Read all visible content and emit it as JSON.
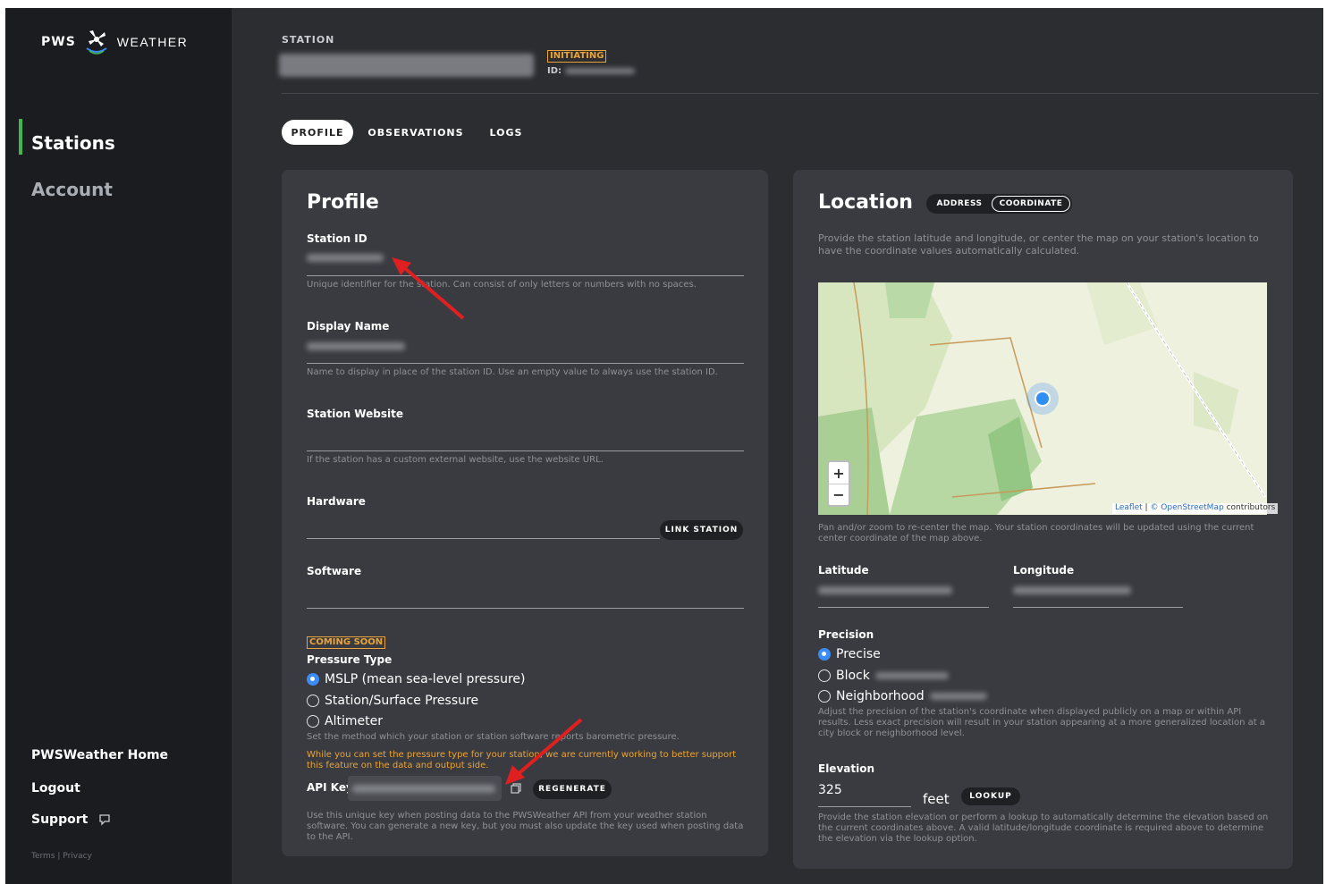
{
  "brand": {
    "pws": "PWS",
    "weather": "WEATHER"
  },
  "nav": {
    "items": [
      {
        "label": "Stations",
        "active": true
      },
      {
        "label": "Account",
        "active": false
      }
    ]
  },
  "footer_links": {
    "home": "PWSWeather Home",
    "logout": "Logout",
    "support": "Support",
    "terms": "Terms",
    "privacy": "Privacy"
  },
  "header": {
    "station_label": "STATION",
    "status": "INITIATING",
    "id_label": "ID:"
  },
  "tabs": [
    "PROFILE",
    "OBSERVATIONS",
    "LOGS"
  ],
  "profile": {
    "title": "Profile",
    "station_id": {
      "label": "Station ID",
      "help": "Unique identifier for the station. Can consist of only letters or numbers with no spaces."
    },
    "display_name": {
      "label": "Display Name",
      "help": "Name to display in place of the station ID. Use an empty value to always use the station ID."
    },
    "website": {
      "label": "Station Website",
      "help": "If the station has a custom external website, use the website URL."
    },
    "hardware": {
      "label": "Hardware",
      "button": "LINK STATION"
    },
    "software": {
      "label": "Software"
    },
    "coming_soon": "COMING SOON",
    "pressure": {
      "label": "Pressure Type",
      "options": [
        "MSLP (mean sea-level pressure)",
        "Station/Surface Pressure",
        "Altimeter"
      ],
      "selected": 0,
      "help": "Set the method which your station or station software reports barometric pressure.",
      "warning": "While you can set the pressure type for your station, we are currently working to better support this feature on the data and output side."
    },
    "api_key": {
      "label": "API Key",
      "button": "REGENERATE",
      "help": "Use this unique key when posting data to the PWSWeather API from your weather station software. You can generate a new key, but you must also update the key used when posting data to the API."
    }
  },
  "location": {
    "title": "Location",
    "toggle": [
      "ADDRESS",
      "COORDINATE"
    ],
    "toggle_selected": 1,
    "intro": "Provide the station latitude and longitude, or center the map on your station's location to have the coordinate values automatically calculated.",
    "map_attrib_leaflet": "Leaflet",
    "map_attrib_osm": "© OpenStreetMap",
    "map_attrib_suffix": "contributors",
    "map_help": "Pan and/or zoom to re-center the map. Your station coordinates will be updated using the current center coordinate of the map above.",
    "latitude_label": "Latitude",
    "longitude_label": "Longitude",
    "precision": {
      "label": "Precision",
      "options": [
        "Precise",
        "Block",
        "Neighborhood"
      ],
      "selected": 0,
      "help": "Adjust the precision of the station's coordinate when displayed publicly on a map or within API results. Less exact precision will result in your station appearing at a more generalized location at a city block or neighborhood level."
    },
    "elevation": {
      "label": "Elevation",
      "value": "325",
      "unit": "feet",
      "button": "LOOKUP",
      "help": "Provide the station elevation or perform a lookup to automatically determine the elevation based on the current coordinates above. A valid latitude/longitude coordinate is required above to determine the elevation via the lookup option."
    }
  },
  "colors": {
    "sidebar_active": "#3fb850",
    "warning": "#e8a33a",
    "radio_selected": "#3b8cf4",
    "annotation_arrow": "#e02020"
  }
}
